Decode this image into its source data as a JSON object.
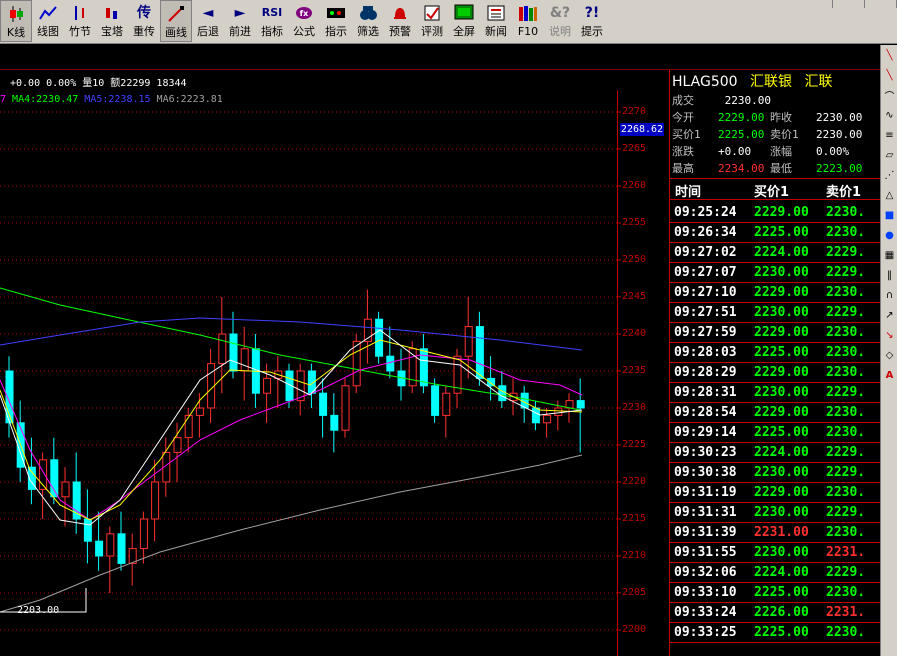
{
  "toolbar": {
    "buttons": [
      {
        "label": "K线",
        "icon": "candlestick-icon",
        "selected": true
      },
      {
        "label": "线图",
        "icon": "line-chart-icon"
      },
      {
        "label": "竹节",
        "icon": "bamboo-chart-icon"
      },
      {
        "label": "宝塔",
        "icon": "tower-chart-icon"
      },
      {
        "label": "重传",
        "icon": "retransmit-icon",
        "glyph": "传"
      },
      {
        "label": "画线",
        "icon": "draw-line-icon",
        "selected": true
      },
      {
        "label": "后退",
        "icon": "back-arrow-icon",
        "glyph": "◄"
      },
      {
        "label": "前进",
        "icon": "forward-arrow-icon",
        "glyph": "►"
      },
      {
        "label": "指标",
        "icon": "rsi-indicator-icon",
        "glyph": "RSI"
      },
      {
        "label": "公式",
        "icon": "formula-icon"
      },
      {
        "label": "指示",
        "icon": "indicator-icon"
      },
      {
        "label": "筛选",
        "icon": "filter-icon"
      },
      {
        "label": "预警",
        "icon": "alarm-bell-icon"
      },
      {
        "label": "评测",
        "icon": "evaluate-icon"
      },
      {
        "label": "全屏",
        "icon": "fullscreen-icon"
      },
      {
        "label": "新闻",
        "icon": "news-icon"
      },
      {
        "label": "F10",
        "icon": "f10-books-icon"
      },
      {
        "label": "说明",
        "icon": "help-icon",
        "glyph": "&?",
        "disabled": true
      },
      {
        "label": "提示",
        "icon": "tips-icon",
        "glyph": "?!"
      }
    ]
  },
  "chart": {
    "info_line": "+0.00  0.00% 量10 额22299 18344",
    "ma_line": [
      {
        "text": "7",
        "color": "#ff00ff"
      },
      {
        "text": "MA4:2230.47",
        "color": "#00ff00"
      },
      {
        "text": "MA5:2238.15",
        "color": "#4040ff"
      },
      {
        "text": "MA6:2223.81",
        "color": "#a0a0a0"
      }
    ],
    "price_tag": "2268.62",
    "low_label": "2203.00",
    "y_labels": [
      "2270",
      "2265",
      "2260",
      "2255",
      "2250",
      "2245",
      "2240",
      "2235",
      "2230",
      "2225",
      "2220",
      "2215",
      "2210",
      "2205",
      "2200"
    ],
    "colors": {
      "up": "#ff3030",
      "down": "#00ffff",
      "ma1": "#ffffff",
      "ma2": "#ffff00",
      "ma3": "#ff00ff",
      "ma4": "#00ff00",
      "ma5": "#4040ff",
      "ma6": "#a0a0a0",
      "grid": "#c00000"
    }
  },
  "quote": {
    "code": "HLAG500",
    "name1": "汇联银",
    "name2": "汇联",
    "last_label": "成交",
    "last_value": "2230.00",
    "rows": [
      {
        "k1": "今开",
        "v1": "2229.00",
        "c1": "#00ff00",
        "k2": "昨收",
        "v2": "2230.00",
        "c2": "#ffffff"
      },
      {
        "k1": "买价1",
        "v1": "2225.00",
        "c1": "#00ff00",
        "k2": "卖价1",
        "v2": "2230.00",
        "c2": "#ffffff"
      },
      {
        "k1": "涨跌",
        "v1": "+0.00",
        "c1": "#ffffff",
        "k2": "涨幅",
        "v2": "0.00%",
        "c2": "#ffffff"
      },
      {
        "k1": "最高",
        "v1": "2234.00",
        "c1": "#ff3030",
        "k2": "最低",
        "v2": "2223.00",
        "c2": "#00ff00"
      }
    ],
    "trade_header": {
      "time": "时间",
      "bid": "买价1",
      "ask": "卖价1"
    },
    "trades": [
      {
        "time": "09:25:24",
        "bid": "2229.00",
        "ask": "2230.",
        "bc": "#00ff00",
        "ac": "#00ff00"
      },
      {
        "time": "09:26:34",
        "bid": "2225.00",
        "ask": "2230.",
        "bc": "#00ff00",
        "ac": "#00ff00"
      },
      {
        "time": "09:27:02",
        "bid": "2224.00",
        "ask": "2229.",
        "bc": "#00ff00",
        "ac": "#00ff00"
      },
      {
        "time": "09:27:07",
        "bid": "2230.00",
        "ask": "2229.",
        "bc": "#00ff00",
        "ac": "#00ff00"
      },
      {
        "time": "09:27:10",
        "bid": "2229.00",
        "ask": "2230.",
        "bc": "#00ff00",
        "ac": "#00ff00"
      },
      {
        "time": "09:27:51",
        "bid": "2230.00",
        "ask": "2229.",
        "bc": "#00ff00",
        "ac": "#00ff00"
      },
      {
        "time": "09:27:59",
        "bid": "2229.00",
        "ask": "2230.",
        "bc": "#00ff00",
        "ac": "#00ff00"
      },
      {
        "time": "09:28:03",
        "bid": "2225.00",
        "ask": "2230.",
        "bc": "#00ff00",
        "ac": "#00ff00"
      },
      {
        "time": "09:28:29",
        "bid": "2229.00",
        "ask": "2230.",
        "bc": "#00ff00",
        "ac": "#00ff00"
      },
      {
        "time": "09:28:31",
        "bid": "2230.00",
        "ask": "2229.",
        "bc": "#00ff00",
        "ac": "#00ff00"
      },
      {
        "time": "09:28:54",
        "bid": "2229.00",
        "ask": "2230.",
        "bc": "#00ff00",
        "ac": "#00ff00"
      },
      {
        "time": "09:29:14",
        "bid": "2225.00",
        "ask": "2230.",
        "bc": "#00ff00",
        "ac": "#00ff00"
      },
      {
        "time": "09:30:23",
        "bid": "2224.00",
        "ask": "2229.",
        "bc": "#00ff00",
        "ac": "#00ff00"
      },
      {
        "time": "09:30:38",
        "bid": "2230.00",
        "ask": "2229.",
        "bc": "#00ff00",
        "ac": "#00ff00"
      },
      {
        "time": "09:31:19",
        "bid": "2229.00",
        "ask": "2230.",
        "bc": "#00ff00",
        "ac": "#00ff00"
      },
      {
        "time": "09:31:31",
        "bid": "2230.00",
        "ask": "2229.",
        "bc": "#00ff00",
        "ac": "#00ff00"
      },
      {
        "time": "09:31:39",
        "bid": "2231.00",
        "ask": "2230.",
        "bc": "#ff3030",
        "ac": "#00ff00"
      },
      {
        "time": "09:31:55",
        "bid": "2230.00",
        "ask": "2231.",
        "bc": "#00ff00",
        "ac": "#ff3030"
      },
      {
        "time": "09:32:06",
        "bid": "2224.00",
        "ask": "2229.",
        "bc": "#00ff00",
        "ac": "#00ff00"
      },
      {
        "time": "09:33:10",
        "bid": "2225.00",
        "ask": "2230.",
        "bc": "#00ff00",
        "ac": "#00ff00"
      },
      {
        "time": "09:33:24",
        "bid": "2226.00",
        "ask": "2231.",
        "bc": "#00ff00",
        "ac": "#ff3030"
      },
      {
        "time": "09:33:25",
        "bid": "2225.00",
        "ask": "2230.",
        "bc": "#00ff00",
        "ac": "#00ff00"
      }
    ]
  },
  "tool_strip": {
    "tools": [
      "line-tool-icon",
      "ray-tool-icon",
      "arc-tool-icon",
      "wave-tool-icon",
      "fib-lines-icon",
      "channel-tool-icon",
      "fan-tool-icon",
      "triangle-tool-icon",
      "rectangle-tool-icon",
      "ellipse-tool-icon",
      "gann-tool-icon",
      "bars-tool-icon",
      "cycle-tool-icon",
      "arrow-up-tool-icon",
      "arrow-down-tool-icon",
      "eraser-tool-icon",
      "text-tool-icon"
    ],
    "text_tool_glyph": "A"
  }
}
